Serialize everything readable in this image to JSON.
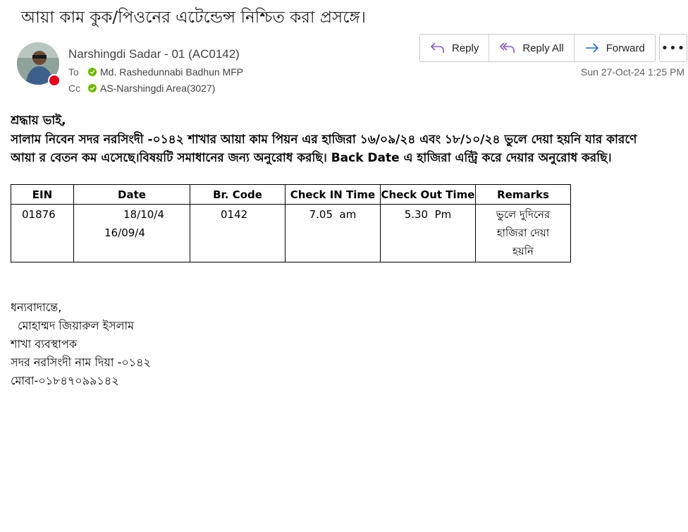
{
  "message": {
    "subject": "আয়া কাম কুক/পিওনের এটেন্ডেন্স নিশ্চিত করা প্রসঙ্গে।",
    "sender": "Narshingdi Sadar - 01 (AC0142)",
    "to_label": "To",
    "to": "Md. Rashedunnabi Badhun MFP",
    "cc_label": "Cc",
    "cc": "AS-Narshingdi Area(3027)",
    "date": "Sun 27-Oct-24 1:25 PM"
  },
  "actions": {
    "reply": "Reply",
    "reply_all": "Reply All",
    "forward": "Forward",
    "more": "•••"
  },
  "body": {
    "greeting": "শ্রদ্ধায় ভাই,",
    "line1": "সালাম নিবেন সদর নরসিংদী -০১৪২ শাখার আয়া কাম পিয়ন এর হাজিরা ১৬/০৯/২৪ এবং ১৮/১০/২৪ ভুলে দেয়া হয়নি যার কারণে",
    "line2": "আয়া র বেতন কম এসেছে।বিষয়টি সমাধানের জন্য অনুরোধ করছি। Back Date এ হাজিরা এন্ট্রি করে দেয়ার অনুরোধ করছি।"
  },
  "table": {
    "headers": [
      "EIN",
      "Date",
      "Br. Code",
      "Check IN Time",
      "Check Out Time",
      "Remarks"
    ],
    "row": {
      "ein": "01876",
      "date1": "18/10/4",
      "date2": "16/09/4",
      "br_code": "0142",
      "check_in": "7.05  am",
      "check_out": "5.30  Pm",
      "remarks1": "ভুলে দুদিনের",
      "remarks2": "হাজিরা দেয়া",
      "remarks3": "হয়নি"
    }
  },
  "signature": {
    "line1": "ধন্যবাদান্তে,",
    "line2": "মোহাম্মদ জিয়ারুল ইসলাম",
    "line3": "শাখা ব্যবস্থাপক",
    "line4": "সদর নরসিংদী নাম দিয়া -০১৪২",
    "line5": "মোবা-০১৮৪৭০৯৯১৪২"
  }
}
